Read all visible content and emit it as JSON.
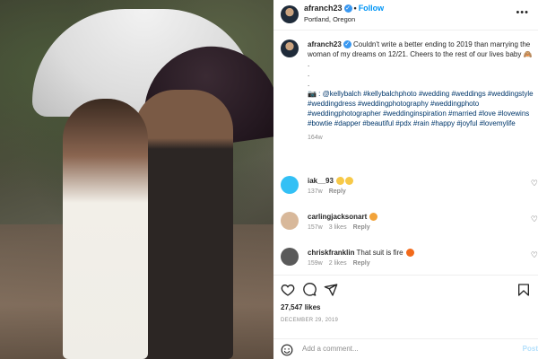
{
  "post": {
    "username": "afranch23",
    "follow_label": "Follow",
    "location": "Portland, Oregon",
    "more_label": "•••"
  },
  "caption": {
    "username": "afranch23",
    "text": "Couldn't write a better ending to 2019 than marrying the woman of my dreams on 12/21. Cheers to the rest of our lives baby",
    "dots": [
      ".",
      ".",
      "."
    ],
    "credit_prefix": "📷 : @kellybalch",
    "credit_tag": "#kellybalchphoto",
    "hashtags": "#wedding #weddings #weddingstyle #weddingdress #weddingphotography #weddingphoto #weddingphotographer #weddinginspiration #married #love #lovewins #bowtie #dapper #beautiful #pdx #rain #happy #joyful #lovemylife",
    "age": "164w"
  },
  "comments": [
    {
      "username": "iak__93",
      "text": "",
      "age": "137w",
      "likes": "",
      "reply": "Reply",
      "avatar_color": "#33c0f5"
    },
    {
      "username": "carlingjacksonart",
      "text": "",
      "age": "157w",
      "likes": "3 likes",
      "reply": "Reply",
      "avatar_color": "#d8b89a"
    },
    {
      "username": "chriskfranklin",
      "text": "That suit is fire",
      "age": "159w",
      "likes": "2 likes",
      "reply": "Reply",
      "avatar_color": "#5a5a5a"
    }
  ],
  "likes": "27,547 likes",
  "date": "DECEMBER 29, 2019",
  "add_comment": {
    "placeholder": "Add a comment...",
    "post_label": "Post"
  },
  "colors": {
    "accent": "#0095f6",
    "verified": "#3897f0",
    "hashtag": "#00376b"
  }
}
